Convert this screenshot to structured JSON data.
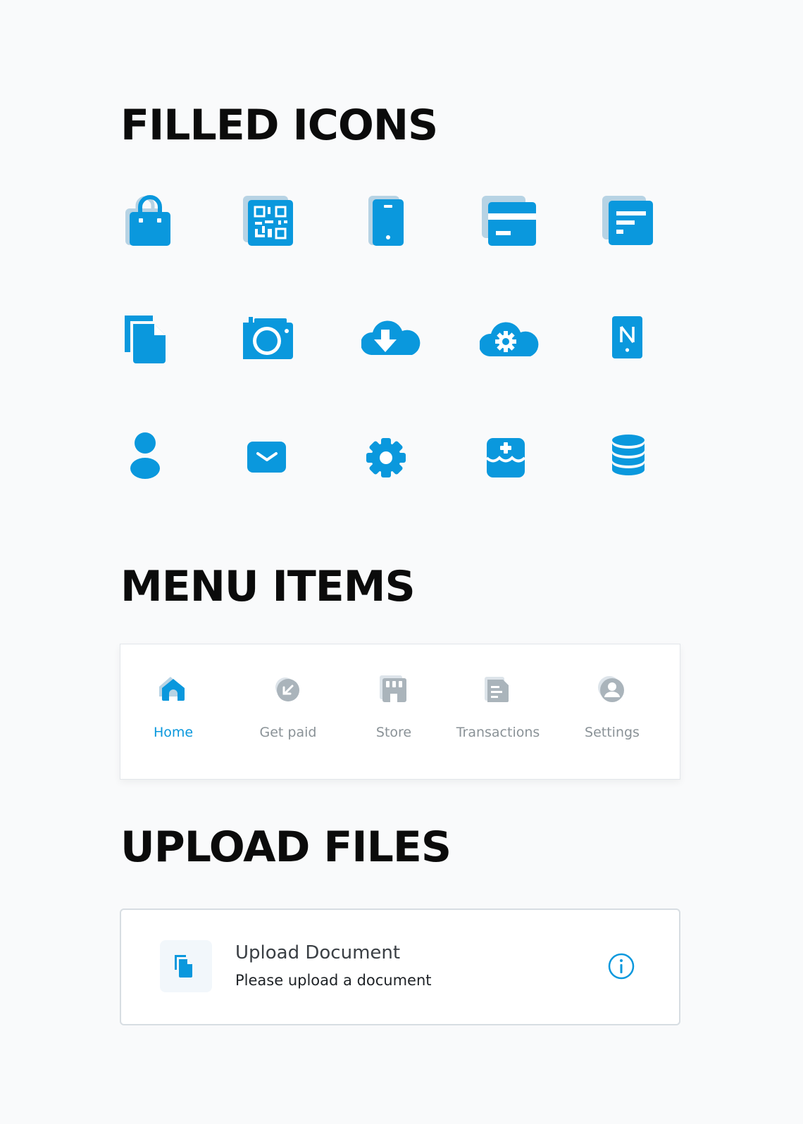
{
  "sections": {
    "icons_title": "FILLED ICONS",
    "menu_title": "MENU ITEMS",
    "upload_title": "UPLOAD FILES"
  },
  "colors": {
    "accent": "#0a98dd",
    "accent_shadow": "#b7d3e4",
    "inactive": "#aab4bb",
    "inactive_shadow": "#dde4ea"
  },
  "icons": [
    "shopping-bag-icon",
    "qr-code-icon",
    "smartphone-icon",
    "credit-card-icon",
    "receipt-icon",
    "document-copy-icon",
    "camera-icon",
    "cloud-download-icon",
    "cloud-settings-icon",
    "nfc-phone-icon",
    "user-icon",
    "mail-icon",
    "gear-icon",
    "medical-kit-icon",
    "database-icon"
  ],
  "menu": {
    "items": [
      {
        "label": "Home",
        "icon": "home-icon",
        "active": true
      },
      {
        "label": "Get paid",
        "icon": "get-paid-icon",
        "active": false
      },
      {
        "label": "Store",
        "icon": "store-icon",
        "active": false
      },
      {
        "label": "Transactions",
        "icon": "transactions-icon",
        "active": false
      },
      {
        "label": "Settings",
        "icon": "settings-user-icon",
        "active": false
      }
    ]
  },
  "upload": {
    "title": "Upload Document",
    "subtitle": "Please upload a document",
    "icon": "document-copy-icon",
    "info_icon": "info-icon"
  }
}
